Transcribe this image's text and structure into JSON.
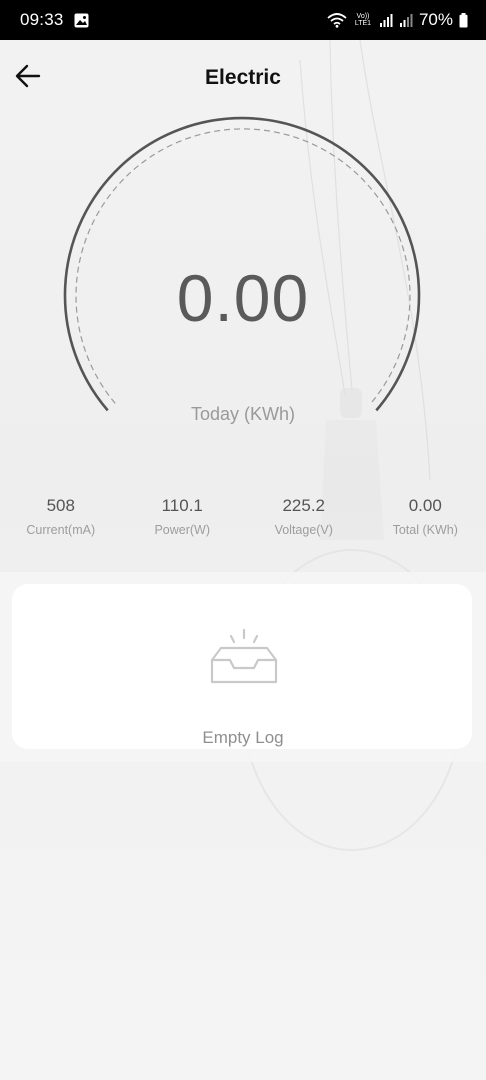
{
  "status_bar": {
    "time": "09:33",
    "network_label": "Vo)) LTE1",
    "battery": "70%"
  },
  "header": {
    "title": "Electric",
    "back_icon": "arrow-left-icon"
  },
  "gauge": {
    "value": "0.00",
    "unit_label": "Today (KWh)"
  },
  "stats": [
    {
      "value": "508",
      "label": "Current(mA)"
    },
    {
      "value": "110.1",
      "label": "Power(W)"
    },
    {
      "value": "225.2",
      "label": "Voltage(V)"
    },
    {
      "value": "0.00",
      "label": "Total (KWh)"
    }
  ],
  "log": {
    "empty_text": "Empty Log",
    "icon": "empty-inbox-icon"
  },
  "colors": {
    "status_bar_bg": "#000000",
    "gauge_arc": "#555555",
    "card_bg": "#ffffff"
  }
}
